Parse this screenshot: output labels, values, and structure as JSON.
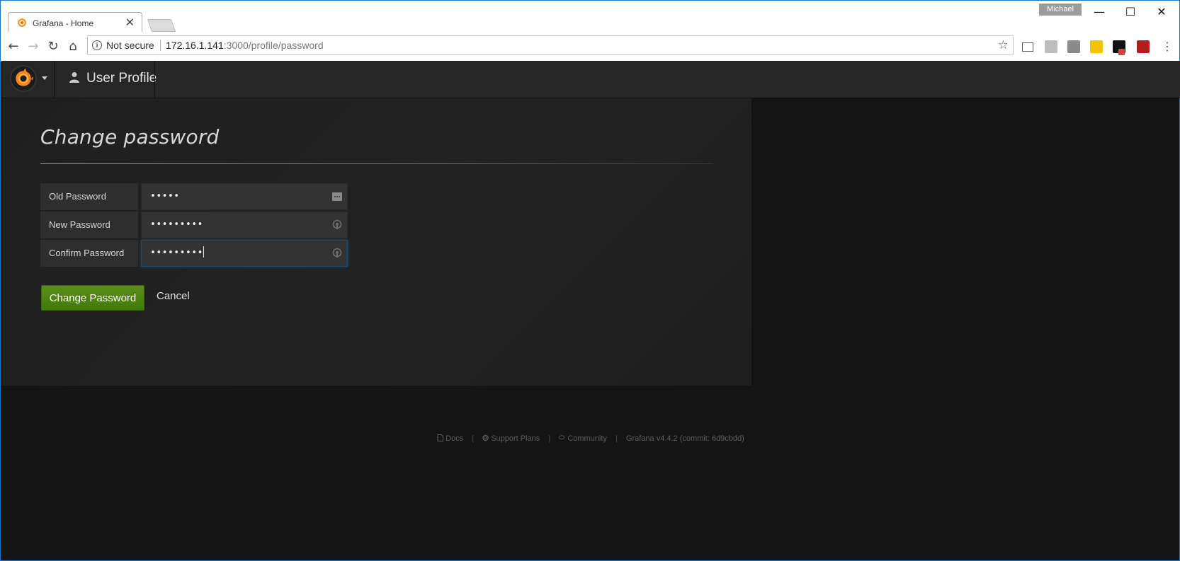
{
  "browser": {
    "tab_title": "Grafana - Home",
    "tab_close": "✕",
    "profile_name": "Michael",
    "window_minimize": "—",
    "window_maximize": "☐",
    "window_close": "✕",
    "security_label": "Not secure",
    "url_host": "172.16.1.141",
    "url_path": ":3000/profile/password"
  },
  "topnav": {
    "page_title": "User Profile"
  },
  "page": {
    "heading": "Change password",
    "fields": [
      {
        "label": "Old Password",
        "value": "•••••"
      },
      {
        "label": "New Password",
        "value": "•••••••••"
      },
      {
        "label": "Confirm Password",
        "value": "•••••••••"
      }
    ],
    "submit_label": "Change Password",
    "cancel_label": "Cancel"
  },
  "footer": {
    "docs": "Docs",
    "support": "Support Plans",
    "community": "Community",
    "version": "Grafana v4.4.2 (commit: 6d9cbdd)",
    "separator": "|"
  },
  "colors": {
    "accent_orange": "#ff7a00",
    "button_green": "#4f8a10",
    "panel_bg": "#1f1f1f",
    "nav_bg": "#262626"
  }
}
